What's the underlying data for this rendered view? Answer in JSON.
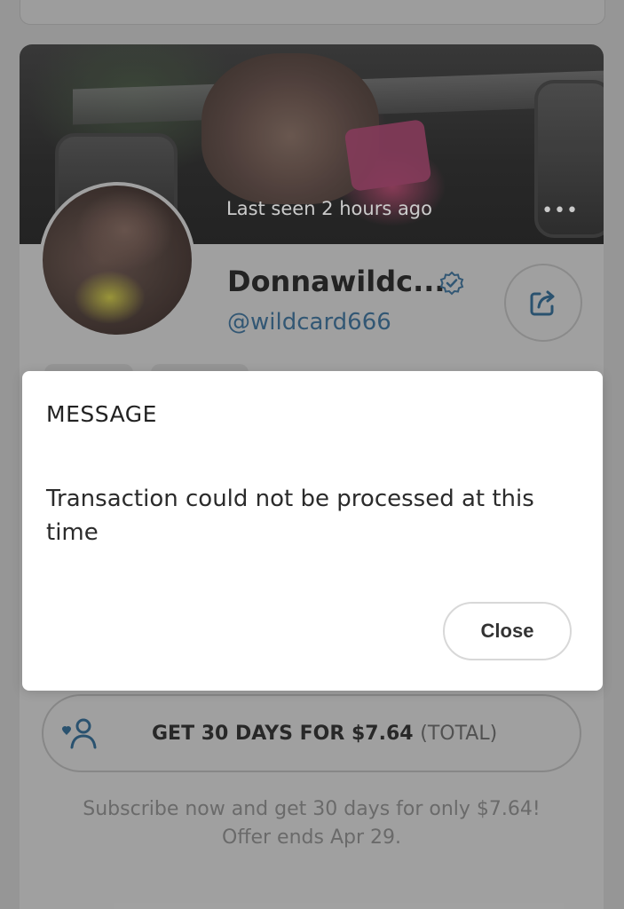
{
  "profile": {
    "last_seen": "Last seen 2 hours ago",
    "display_name": "Donnawildc...",
    "handle": "@wildcard666",
    "more_icon": "more-horizontal-icon",
    "verified_icon": "verified-check-icon",
    "share_icon": "share-icon"
  },
  "subscribe": {
    "label": "GET 30 DAYS FOR $7.64",
    "total": "(TOTAL)",
    "icon": "add-user-heart-icon",
    "offer_line1": "Subscribe now and get 30 days for only $7.64!",
    "offer_line2": "Offer ends Apr 29."
  },
  "modal": {
    "title": "MESSAGE",
    "body": "Transaction could not be processed at this time",
    "close_label": "Close"
  },
  "colors": {
    "accent": "#00aff0",
    "handle": "#345a78",
    "modal_bg": "#ffffff",
    "dim_bg": "#9b9b9b"
  }
}
